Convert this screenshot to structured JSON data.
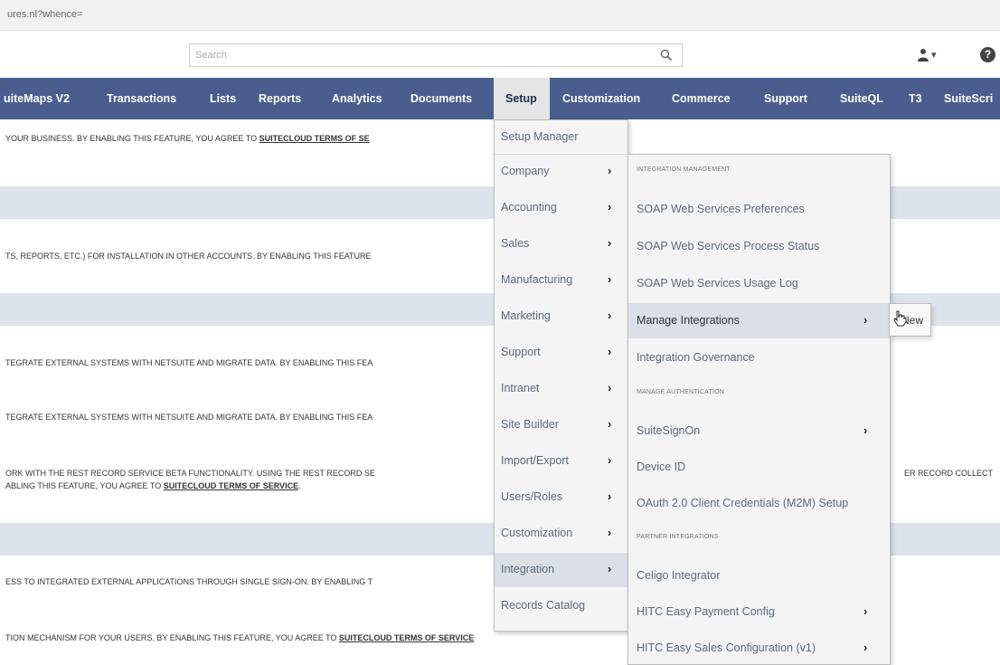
{
  "browser": {
    "url": "ures.nl?whence="
  },
  "header": {
    "search_placeholder": "Search",
    "person_caret": "▾",
    "help_label": "?"
  },
  "nav": {
    "items": [
      {
        "label": "uiteMaps V2"
      },
      {
        "label": "Transactions"
      },
      {
        "label": "Lists"
      },
      {
        "label": "Reports"
      },
      {
        "label": "Analytics"
      },
      {
        "label": "Documents"
      },
      {
        "label": "Setup",
        "active": true
      },
      {
        "label": "Customization"
      },
      {
        "label": "Commerce"
      },
      {
        "label": "Support"
      },
      {
        "label": "SuiteQL"
      },
      {
        "label": "T3"
      },
      {
        "label": "SuiteScri"
      }
    ]
  },
  "content": {
    "rows": [
      {
        "text": "YOUR BUSINESS. BY ENABLING THIS FEATURE, YOU AGREE TO ",
        "link": "SUITECLOUD TERMS OF SE"
      },
      {
        "text": "TS, REPORTS, ETC.) FOR INSTALLATION IN OTHER ACCOUNTS. BY ENABLING THIS FEATURE"
      },
      {
        "text": "TEGRATE EXTERNAL SYSTEMS WITH NETSUITE AND MIGRATE DATA. BY ENABLING THIS FEA"
      },
      {
        "text": "TEGRATE EXTERNAL SYSTEMS WITH NETSUITE AND MIGRATE DATA. BY ENABLING THIS FEA"
      },
      {
        "text": "ORK WITH THE REST RECORD SERVICE BETA FUNCTIONALITY. USING THE REST RECORD SE"
      },
      {
        "text": "ABLING THIS FEATURE, YOU AGREE TO ",
        "link": "SUITECLOUD TERMS OF SERVICE",
        "tail": "."
      },
      {
        "text": "ER RECORD COLLECT"
      },
      {
        "text": "ESS TO INTEGRATED EXTERNAL APPLICATIONS THROUGH SINGLE SIGN-ON. BY ENABLING T"
      },
      {
        "text": "TION MECHANISM FOR YOUR USERS. BY ENABLING THIS FEATURE, YOU AGREE TO ",
        "link": "SUITECLOUD TERMS OF SERVICE"
      }
    ]
  },
  "setup_menu": {
    "items": [
      {
        "label": "Setup Manager",
        "chevron": ""
      },
      {
        "label": "Company",
        "chevron": "›"
      },
      {
        "label": "Accounting",
        "chevron": "›"
      },
      {
        "label": "Sales",
        "chevron": "›"
      },
      {
        "label": "Manufacturing",
        "chevron": "›"
      },
      {
        "label": "Marketing",
        "chevron": "›"
      },
      {
        "label": "Support",
        "chevron": "›"
      },
      {
        "label": "Intranet",
        "chevron": "›"
      },
      {
        "label": "Site Builder",
        "chevron": "›"
      },
      {
        "label": "Import/Export",
        "chevron": "›"
      },
      {
        "label": "Users/Roles",
        "chevron": "›"
      },
      {
        "label": "Customization",
        "chevron": "›"
      },
      {
        "label": "Integration",
        "chevron": "›",
        "highlighted": true
      },
      {
        "label": "Records Catalog",
        "chevron": ""
      }
    ]
  },
  "integration_menu": {
    "section_integration": "INTEGRATION MANAGEMENT",
    "soap_prefs": "SOAP Web Services Preferences",
    "soap_status": "SOAP Web Services Process Status",
    "soap_log": "SOAP Web Services Usage Log",
    "manage_integrations": "Manage Integrations",
    "integration_governance": "Integration Governance",
    "section_auth": "MANAGE AUTHENTICATION",
    "suitesignon": "SuiteSignOn",
    "device_id": "Device ID",
    "oauth": "OAuth 2.0 Client Credentials (M2M) Setup",
    "section_partner": "PARTNER INTEGRATIONS",
    "celigo": "Celigo Integrator",
    "hitc_payment": "HITC Easy Payment Config",
    "hitc_sales": "HITC Easy Sales Configuration (v1)",
    "chevron": "›"
  },
  "submenu": {
    "new_label": "New"
  },
  "colors": {
    "nav_bg": "#4a5d8f",
    "band": "#dde2eb",
    "menu_bg": "#f4f4f4",
    "menu_highlight": "#dcdfe6"
  }
}
